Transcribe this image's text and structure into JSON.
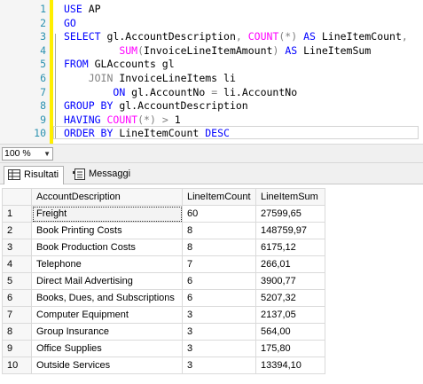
{
  "editor": {
    "lines": [
      {
        "num": "1",
        "tokens": [
          {
            "t": "USE",
            "c": "kw"
          },
          {
            "t": " AP",
            "c": ""
          }
        ]
      },
      {
        "num": "2",
        "tokens": [
          {
            "t": "GO",
            "c": "kw"
          }
        ]
      },
      {
        "num": "3",
        "tokens": [
          {
            "t": "SELECT",
            "c": "kw"
          },
          {
            "t": " gl.AccountDescription",
            "c": ""
          },
          {
            "t": ",",
            "c": "op"
          },
          {
            "t": " ",
            "c": ""
          },
          {
            "t": "COUNT",
            "c": "fn"
          },
          {
            "t": "(*)",
            "c": "op"
          },
          {
            "t": " ",
            "c": ""
          },
          {
            "t": "AS",
            "c": "kw"
          },
          {
            "t": " LineItemCount",
            "c": ""
          },
          {
            "t": ",",
            "c": "op"
          }
        ]
      },
      {
        "num": "4",
        "tokens": [
          {
            "t": "         ",
            "c": ""
          },
          {
            "t": "SUM",
            "c": "fn"
          },
          {
            "t": "(",
            "c": "op"
          },
          {
            "t": "InvoiceLineItemAmount",
            "c": ""
          },
          {
            "t": ")",
            "c": "op"
          },
          {
            "t": " ",
            "c": ""
          },
          {
            "t": "AS",
            "c": "kw"
          },
          {
            "t": " LineItemSum",
            "c": ""
          }
        ]
      },
      {
        "num": "5",
        "tokens": [
          {
            "t": "FROM",
            "c": "kw"
          },
          {
            "t": " GLAccounts gl",
            "c": ""
          }
        ]
      },
      {
        "num": "6",
        "tokens": [
          {
            "t": "    ",
            "c": ""
          },
          {
            "t": "JOIN",
            "c": "op"
          },
          {
            "t": " InvoiceLineItems li",
            "c": ""
          }
        ]
      },
      {
        "num": "7",
        "tokens": [
          {
            "t": "        ",
            "c": ""
          },
          {
            "t": "ON",
            "c": "kw"
          },
          {
            "t": " gl.AccountNo ",
            "c": ""
          },
          {
            "t": "=",
            "c": "op"
          },
          {
            "t": " li.AccountNo",
            "c": ""
          }
        ]
      },
      {
        "num": "8",
        "tokens": [
          {
            "t": "GROUP BY",
            "c": "kw"
          },
          {
            "t": " gl.AccountDescription",
            "c": ""
          }
        ]
      },
      {
        "num": "9",
        "tokens": [
          {
            "t": "HAVING",
            "c": "kw"
          },
          {
            "t": " ",
            "c": ""
          },
          {
            "t": "COUNT",
            "c": "fn"
          },
          {
            "t": "(*)",
            "c": "op"
          },
          {
            "t": " ",
            "c": ""
          },
          {
            "t": ">",
            "c": "op"
          },
          {
            "t": " 1",
            "c": ""
          }
        ]
      },
      {
        "num": "10",
        "tokens": [
          {
            "t": "ORDER BY",
            "c": "kw"
          },
          {
            "t": " LineItemCount ",
            "c": ""
          },
          {
            "t": "DESC",
            "c": "kw"
          }
        ]
      }
    ]
  },
  "zoom": {
    "value": "100 %"
  },
  "tabs": {
    "results_label": "Risultati",
    "messages_label": "Messaggi"
  },
  "results": {
    "columns": [
      "",
      "AccountDescription",
      "LineItemCount",
      "LineItemSum"
    ],
    "rows": [
      [
        "1",
        "Freight",
        "60",
        "27599,65"
      ],
      [
        "2",
        "Book Printing Costs",
        "8",
        "148759,97"
      ],
      [
        "3",
        "Book Production Costs",
        "8",
        "6175,12"
      ],
      [
        "4",
        "Telephone",
        "7",
        "266,01"
      ],
      [
        "5",
        "Direct Mail Advertising",
        "6",
        "3900,77"
      ],
      [
        "6",
        "Books, Dues, and Subscriptions",
        "6",
        "5207,32"
      ],
      [
        "7",
        "Computer Equipment",
        "3",
        "2137,05"
      ],
      [
        "8",
        "Group Insurance",
        "3",
        "564,00"
      ],
      [
        "9",
        "Office Supplies",
        "3",
        "175,80"
      ],
      [
        "10",
        "Outside Services",
        "3",
        "13394,10"
      ]
    ]
  }
}
